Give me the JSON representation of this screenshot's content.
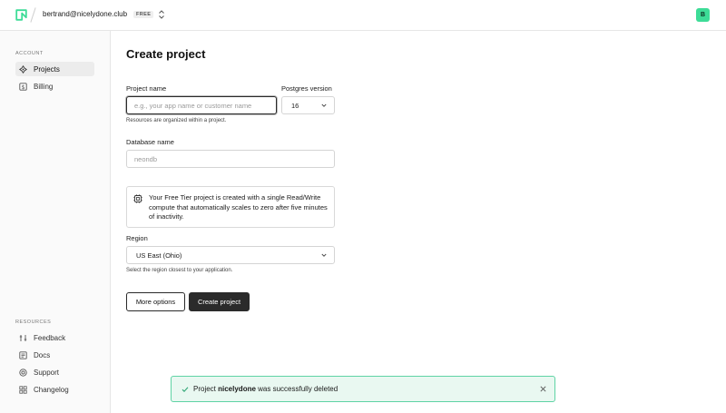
{
  "header": {
    "account_email": "bertrand@nicelydone.club",
    "plan_badge": "FREE",
    "avatar_initial": "B",
    "brand_color": "#3ddc97"
  },
  "sidebar": {
    "account_section_label": "ACCOUNT",
    "account_items": [
      {
        "label": "Projects",
        "icon": "projects-icon",
        "active": true
      },
      {
        "label": "Billing",
        "icon": "billing-icon",
        "active": false
      }
    ],
    "resources_section_label": "RESOURCES",
    "resource_items": [
      {
        "label": "Feedback",
        "icon": "feedback-icon"
      },
      {
        "label": "Docs",
        "icon": "docs-icon"
      },
      {
        "label": "Support",
        "icon": "support-icon"
      },
      {
        "label": "Changelog",
        "icon": "changelog-icon"
      }
    ]
  },
  "form": {
    "title": "Create project",
    "project_name": {
      "label": "Project name",
      "placeholder": "e.g., your app name or customer name",
      "value": "",
      "hint": "Resources are organized within a project."
    },
    "postgres_version": {
      "label": "Postgres version",
      "value": "16"
    },
    "database_name": {
      "label": "Database name",
      "placeholder": "neondb",
      "value": ""
    },
    "notice": "Your Free Tier project is created with a single Read/Write compute that automatically scales to zero after five minutes of inactivity.",
    "region": {
      "label": "Region",
      "value": "US East (Ohio)",
      "hint": "Select the region closest to your application."
    },
    "more_options_label": "More options",
    "create_label": "Create project"
  },
  "toast": {
    "prefix": "Project ",
    "project": "nicelydone",
    "suffix": " was successfully deleted",
    "status_color": "#5fd3a5"
  }
}
